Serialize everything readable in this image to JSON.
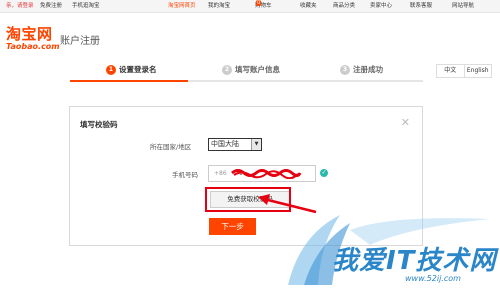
{
  "topbar": {
    "greeting": "亲，请登录",
    "register": "免费注册",
    "mobile": "手机逛淘宝",
    "home": "淘宝网首页",
    "my_taobao": "我的淘宝",
    "cart": "购物车",
    "cart_count": "0",
    "favorites": "收藏夹",
    "categories": "商品分类",
    "seller": "卖家中心",
    "service": "联系客服",
    "sitemap": "网站导航"
  },
  "logo": {
    "cn": "淘宝网",
    "en": "Taobao.com"
  },
  "page_title": "账户注册",
  "steps": [
    {
      "num": "1",
      "label": "设置登录名"
    },
    {
      "num": "2",
      "label": "填写账户信息"
    },
    {
      "num": "3",
      "label": "注册成功"
    }
  ],
  "lang": {
    "zh": "中文",
    "en": "English"
  },
  "dialog": {
    "title": "填写校验码",
    "region_label": "所在国家/地区",
    "region_value": "中国大陆",
    "phone_label": "手机号码",
    "phone_prefix": "+86",
    "phone_value": "1",
    "code_button": "免费获取校验码",
    "next_button": "下一步"
  },
  "watermark": {
    "text": "我爱IT技术网",
    "url": "www.52ij.com"
  },
  "colors": {
    "accent": "#ff4400",
    "highlight": "#e60012",
    "watermark": "#2a86c8"
  }
}
